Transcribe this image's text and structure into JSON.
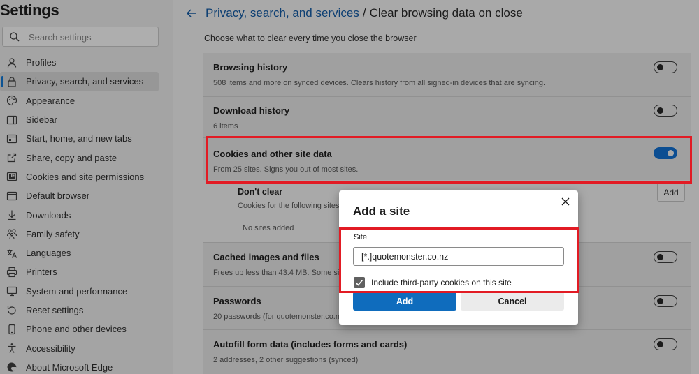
{
  "sidebar": {
    "title": "Settings",
    "search_placeholder": "Search settings",
    "items": [
      {
        "label": "Profiles",
        "icon": "profile-icon"
      },
      {
        "label": "Privacy, search, and services",
        "icon": "lock-icon",
        "active": true
      },
      {
        "label": "Appearance",
        "icon": "appearance-icon"
      },
      {
        "label": "Sidebar",
        "icon": "sidebar-icon"
      },
      {
        "label": "Start, home, and new tabs",
        "icon": "home-icon"
      },
      {
        "label": "Share, copy and paste",
        "icon": "share-icon"
      },
      {
        "label": "Cookies and site permissions",
        "icon": "site-permissions-icon"
      },
      {
        "label": "Default browser",
        "icon": "browser-icon"
      },
      {
        "label": "Downloads",
        "icon": "download-icon"
      },
      {
        "label": "Family safety",
        "icon": "family-icon"
      },
      {
        "label": "Languages",
        "icon": "languages-icon"
      },
      {
        "label": "Printers",
        "icon": "printer-icon"
      },
      {
        "label": "System and performance",
        "icon": "system-icon"
      },
      {
        "label": "Reset settings",
        "icon": "reset-icon"
      },
      {
        "label": "Phone and other devices",
        "icon": "phone-icon"
      },
      {
        "label": "Accessibility",
        "icon": "accessibility-icon"
      },
      {
        "label": "About Microsoft Edge",
        "icon": "edge-icon"
      }
    ]
  },
  "header": {
    "parent_link": "Privacy, search, and services",
    "separator": "/",
    "current": "Clear browsing data on close"
  },
  "intro": "Choose what to clear every time you close the browser",
  "rows": {
    "browsing_history": {
      "title": "Browsing history",
      "subtitle": "508 items and more on synced devices. Clears history from all signed-in devices that are syncing.",
      "on": false
    },
    "download_history": {
      "title": "Download history",
      "subtitle": "6 items",
      "on": false
    },
    "cookies": {
      "title": "Cookies and other site data",
      "subtitle": "From 25 sites. Signs you out of most sites.",
      "on": true
    },
    "cached": {
      "title": "Cached images and files",
      "subtitle": "Frees up less than 43.4 MB. Some sites c",
      "on": false
    },
    "passwords": {
      "title": "Passwords",
      "subtitle": "20 passwords (for quotemonster.co.nz, a",
      "on": false
    },
    "autofill": {
      "title": "Autofill form data (includes forms and cards)",
      "subtitle": "2 addresses, 2 other suggestions (synced)",
      "on": false
    }
  },
  "dont_clear": {
    "title": "Don't clear",
    "subtitle": "Cookies for the following sites w",
    "empty": "No sites added",
    "add_label": "Add"
  },
  "dialog": {
    "title": "Add a site",
    "site_label": "Site",
    "site_value": "[*.]quotemonster.co.nz",
    "checkbox_label": "Include third-party cookies on this site",
    "checkbox_checked": true,
    "add_label": "Add",
    "cancel_label": "Cancel"
  },
  "colors": {
    "accent": "#0f6cbd",
    "highlight": "#e21b24",
    "toggle_on": "#0c4e92"
  }
}
